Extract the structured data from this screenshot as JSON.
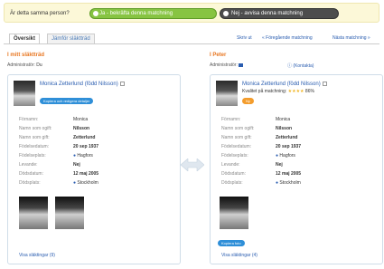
{
  "topbar": {
    "question": "Är detta samma person?",
    "confirm_label": "Ja - bekräfta denna matchning",
    "reject_label": "Nej - avvisa denna matchning"
  },
  "tabs": [
    {
      "label": "Översikt"
    },
    {
      "label": "Jämför släktträd"
    }
  ],
  "nav": {
    "skriv_ut": "Skriv ut",
    "previous": "« Föregående matchning",
    "next": "Nästa matchning »"
  },
  "left": {
    "section_title": "I mitt släktträd",
    "admin_label": "Administratör:",
    "admin_value": "Du",
    "name": "Monica Zetterlund (född Nilsson)",
    "edit_button": "Kopiera och redigera detaljer",
    "fields": [
      {
        "label": "Förnamn:",
        "value": "Monica"
      },
      {
        "label": "Namn som ogift:",
        "value": "Nilsson"
      },
      {
        "label": "Namn som gift:",
        "value": "Zetterlund"
      },
      {
        "label": "Födelsedatum:",
        "value": "20 sep 1937"
      },
      {
        "label": "Födelseplats:",
        "value": "Hagfors"
      },
      {
        "label": "Levande:",
        "value": "Nej"
      },
      {
        "label": "Dödsdatum:",
        "value": "12 maj 2005"
      },
      {
        "label": "Dödsplats:",
        "value": "Stockholm"
      }
    ],
    "footer": "Visa släktingar (9)"
  },
  "right": {
    "section_title": "I Peter",
    "admin_label": "Administratör:",
    "contact": "(Kontakta)",
    "name": "Monica Zetterlund (född Nilsson)",
    "quality_label": "Kvalitet på matchning:",
    "quality_percent": "86%",
    "quality_stars": 4,
    "badge": "Ny",
    "fields": [
      {
        "label": "Förnamn:",
        "value": "Monica"
      },
      {
        "label": "Namn som ogift:",
        "value": "Nilsson"
      },
      {
        "label": "Namn som gift:",
        "value": "Zetterlund"
      },
      {
        "label": "Födelsedatum:",
        "value": "20 sep 1937"
      },
      {
        "label": "Födelseplats:",
        "value": "Hagfors"
      },
      {
        "label": "Levande:",
        "value": "Nej"
      },
      {
        "label": "Dödsdatum:",
        "value": "12 maj 2005"
      },
      {
        "label": "Dödsplats:",
        "value": "Stockholm"
      }
    ],
    "copy_photo_button": "Kopiera foto",
    "footer": "Visa släktingar (4)"
  },
  "colors": {
    "accent_orange": "#e87722",
    "link_blue": "#2a5db0",
    "confirm_green": "#87c442",
    "reject_dark": "#4d4d4d"
  }
}
